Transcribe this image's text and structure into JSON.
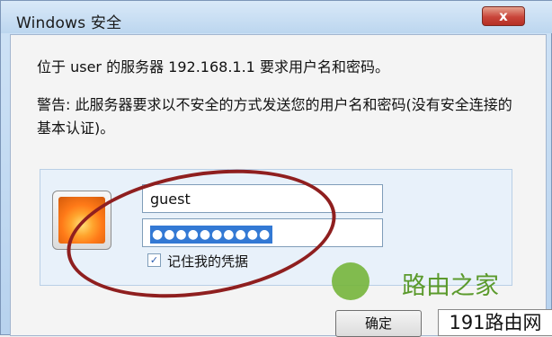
{
  "window": {
    "title": "Windows 安全",
    "close_label": "x"
  },
  "messages": {
    "line1": "位于 user 的服务器 192.168.1.1 要求用户名和密码。",
    "line2": "警告: 此服务器要求以不安全的方式发送您的用户名和密码(没有安全连接的基本认证)。"
  },
  "credentials": {
    "username": "guest",
    "password_mask": "●●●●●●●●●●",
    "remember_label": "记住我的凭据",
    "remember_checked": true,
    "remember_mark": "✓"
  },
  "buttons": {
    "ok_label": "确定"
  },
  "watermark": {
    "text": "路由之家"
  },
  "corner_brand": {
    "text": "191路由网"
  },
  "colors": {
    "annotation_ellipse": "#8f1f1f",
    "selection": "#3379d4",
    "watermark_green": "#5b9a2c"
  }
}
